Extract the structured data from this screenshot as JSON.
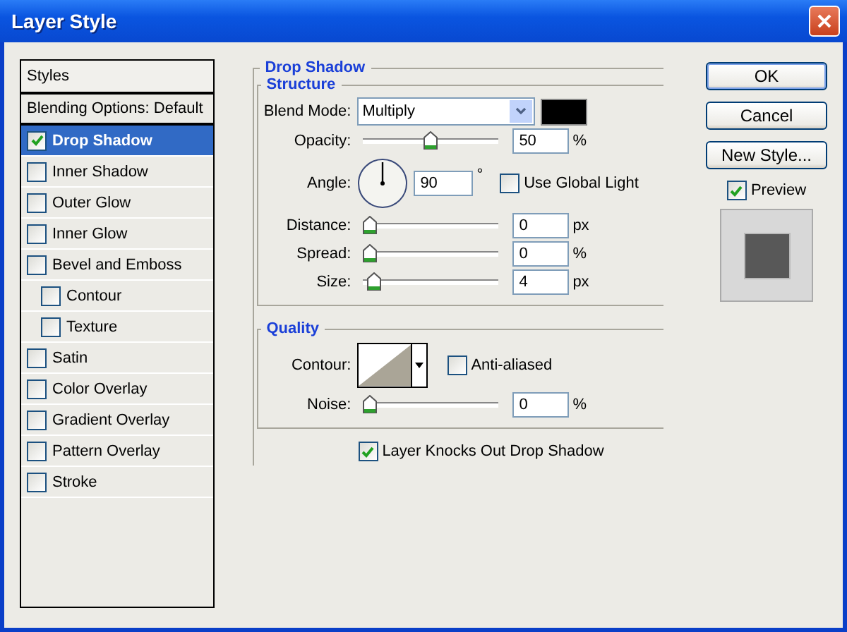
{
  "window": {
    "title": "Layer Style"
  },
  "styles_panel": {
    "header": "Styles",
    "items": [
      {
        "label": "Blending Options: Default",
        "kind": "plain",
        "selected": false
      },
      {
        "label": "Drop Shadow",
        "kind": "check",
        "checked": true,
        "selected": true
      },
      {
        "label": "Inner Shadow",
        "kind": "check",
        "checked": false,
        "selected": false
      },
      {
        "label": "Outer Glow",
        "kind": "check",
        "checked": false,
        "selected": false
      },
      {
        "label": "Inner Glow",
        "kind": "check",
        "checked": false,
        "selected": false
      },
      {
        "label": "Bevel and Emboss",
        "kind": "check",
        "checked": false,
        "selected": false,
        "children": [
          {
            "label": "Contour",
            "kind": "check",
            "checked": false,
            "selected": false
          },
          {
            "label": "Texture",
            "kind": "check",
            "checked": false,
            "selected": false
          }
        ]
      },
      {
        "label": "Satin",
        "kind": "check",
        "checked": false,
        "selected": false
      },
      {
        "label": "Color Overlay",
        "kind": "check",
        "checked": false,
        "selected": false
      },
      {
        "label": "Gradient Overlay",
        "kind": "check",
        "checked": false,
        "selected": false
      },
      {
        "label": "Pattern Overlay",
        "kind": "check",
        "checked": false,
        "selected": false
      },
      {
        "label": "Stroke",
        "kind": "check",
        "checked": false,
        "selected": false
      }
    ]
  },
  "drop_shadow": {
    "title": "Drop Shadow",
    "structure": {
      "title": "Structure",
      "rows": [
        {
          "kind": "select",
          "label": "Blend Mode:",
          "value": "Multiply",
          "color": "#000000"
        },
        {
          "kind": "slider",
          "label": "Opacity:",
          "level": 0.5,
          "value": "50",
          "unit": "%"
        },
        {
          "kind": "angle",
          "label": "Angle:",
          "value": "90",
          "unit": "°",
          "option": {
            "label": "Use Global Light",
            "checked": false
          }
        },
        {
          "kind": "slider",
          "label": "Distance:",
          "level": 0,
          "value": "0",
          "unit": "px"
        },
        {
          "kind": "slider",
          "label": "Spread:",
          "level": 0,
          "value": "0",
          "unit": "%"
        },
        {
          "kind": "slider",
          "label": "Size:",
          "level": 0.04,
          "value": "4",
          "unit": "px"
        }
      ]
    },
    "quality": {
      "title": "Quality",
      "rows": [
        {
          "kind": "contour",
          "label": "Contour:",
          "option": {
            "label": "Anti-aliased",
            "checked": false
          }
        },
        {
          "kind": "slider",
          "label": "Noise:",
          "level": 0,
          "value": "0",
          "unit": "%"
        }
      ]
    },
    "knockout": {
      "label": "Layer Knocks Out Drop Shadow",
      "checked": true
    }
  },
  "buttons": [
    {
      "label": "OK",
      "default": true
    },
    {
      "label": "Cancel",
      "default": false
    },
    {
      "label": "New Style...",
      "default": false
    }
  ],
  "preview": {
    "label": "Preview",
    "checked": true
  }
}
